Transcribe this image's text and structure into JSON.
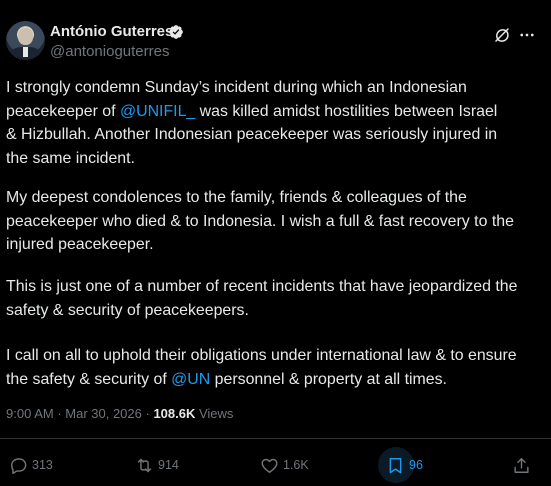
{
  "author": {
    "name": "António Guterres",
    "handle": "@antonioguterres",
    "verified": true
  },
  "tweet": {
    "paragraphs": [
      {
        "lines": [
          [
            {
              "text": "I strongly condemn Sunday’s incident during which an Indonesian"
            }
          ],
          [
            {
              "text": "peacekeeper of "
            },
            {
              "text": "@UNIFIL_",
              "mention": true
            },
            {
              "text": " was killed amidst hostilities between Israel"
            }
          ],
          [
            {
              "text": "& Hizbullah. Another Indonesian peacekeeper was seriously injured in"
            }
          ],
          [
            {
              "text": "the same incident."
            }
          ]
        ]
      },
      {
        "lines": [
          [
            {
              "text": "My deepest condolences to the family, friends & colleagues of the"
            }
          ],
          [
            {
              "text": "peacekeeper who died & to Indonesia. I wish a full & fast recovery to the"
            }
          ],
          [
            {
              "text": "injured peacekeeper."
            }
          ]
        ]
      },
      {
        "lines": [
          [
            {
              "text": "This is just one of a number of recent incidents that have jeopardized the"
            }
          ],
          [
            {
              "text": "safety & security of peacekeepers."
            }
          ]
        ]
      },
      {
        "lines": [
          [
            {
              "text": "I call on all to uphold their obligations under international law & to ensure"
            }
          ],
          [
            {
              "text": "the safety & security of "
            },
            {
              "text": "@UN",
              "mention": true
            },
            {
              "text": " personnel & property at all times."
            }
          ]
        ]
      }
    ]
  },
  "meta": {
    "time": "9:00 AM",
    "separator": " · ",
    "date": "Mar 30, 2026",
    "views_count": "108.6K",
    "views_label": " Views"
  },
  "actions": {
    "replies": "313",
    "reposts": "914",
    "likes": "1.6K",
    "bookmarks": "96"
  },
  "colors": {
    "background": "#000000",
    "text": "#e7e9ea",
    "secondary": "#71767b",
    "accent": "#1d9bf0",
    "divider": "#2f3336"
  },
  "icons": {
    "verified": "verified-badge-icon",
    "grok": "grok-icon",
    "more": "more-icon",
    "reply": "reply-icon",
    "repost": "repost-icon",
    "like": "heart-icon",
    "bookmark": "bookmark-icon",
    "share": "share-icon"
  }
}
